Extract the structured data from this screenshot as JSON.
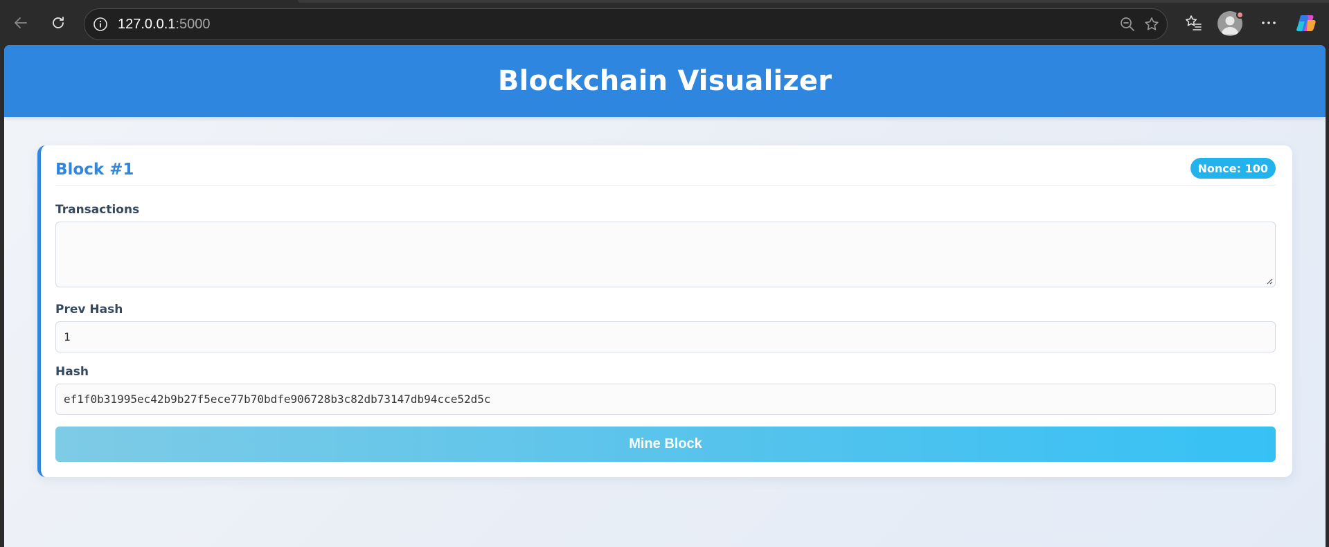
{
  "browser": {
    "url_host": "127.0.0.1",
    "url_port": ":5000",
    "icons": [
      "back-icon",
      "reload-icon",
      "site-info-icon",
      "zoom-out-icon",
      "star-icon",
      "favorites-icon",
      "profile-icon",
      "more-icon",
      "copilot-icon"
    ]
  },
  "page": {
    "title": "Blockchain Visualizer",
    "accent_color": "#2e86de",
    "block": {
      "title": "Block #1",
      "nonce_label": "Nonce: 100",
      "transactions_label": "Transactions",
      "transactions_value": "",
      "prev_hash_label": "Prev Hash",
      "prev_hash_value": "1",
      "hash_label": "Hash",
      "hash_value": "ef1f0b31995ec42b9b27f5ece77b70bdfe906728b3c82db73147db94cce52d5c",
      "mine_button_label": "Mine Block"
    }
  }
}
